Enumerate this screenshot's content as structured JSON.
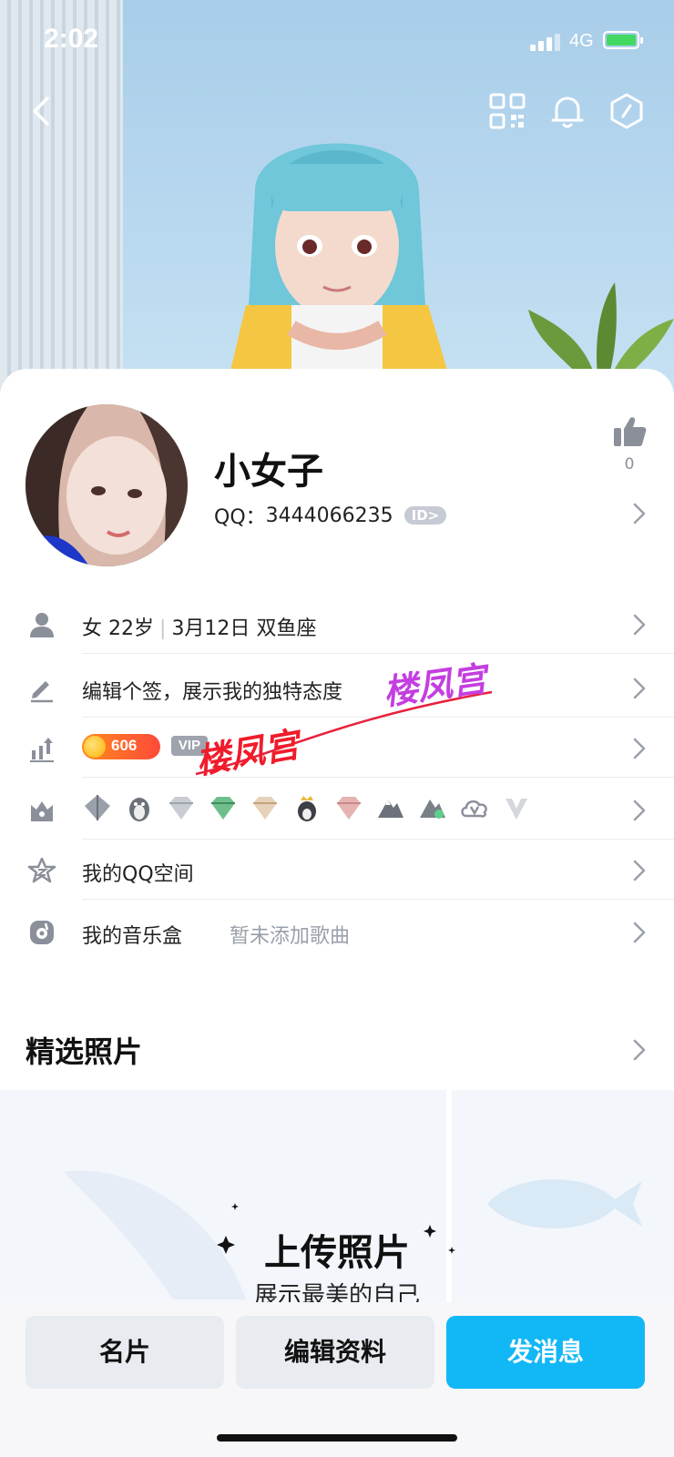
{
  "status_bar": {
    "time": "2:02",
    "network": "4G"
  },
  "profile": {
    "nickname": "小女子",
    "qq_prefix": "QQ：",
    "qq_number": "3444066235",
    "id_badge": "ID>",
    "like_count": "0"
  },
  "info_rows": {
    "gender": "女",
    "age": "22岁",
    "divider": "|",
    "birthday": "3月12日",
    "zodiac": "双鱼座",
    "signature": "编辑个签，展示我的独特态度",
    "level_value": "606",
    "vip_label": "VIP",
    "qzone": "我的QQ空间",
    "music_label": "我的音乐盒",
    "music_status": "暂未添加歌曲"
  },
  "medals": [
    "diamond-grey",
    "penguin-grey",
    "diamond-silver",
    "diamond-green",
    "diamond-gold",
    "penguin-crown",
    "diamond-pink",
    "mountain-grey",
    "mountain-green",
    "cloud-v",
    "v-grey"
  ],
  "watermark": {
    "text1": "楼凤宫",
    "text2": "楼凤宫"
  },
  "photos": {
    "section_title": "精选照片",
    "upload_title": "上传照片",
    "upload_subtitle": "展示最美的自己"
  },
  "actions": {
    "card_label": "名片",
    "edit_label": "编辑资料",
    "message_label": "发消息"
  },
  "colors": {
    "accent": "#12b7f5",
    "button_grey": "#e8ebf0",
    "icon_grey": "#8a8f99"
  }
}
